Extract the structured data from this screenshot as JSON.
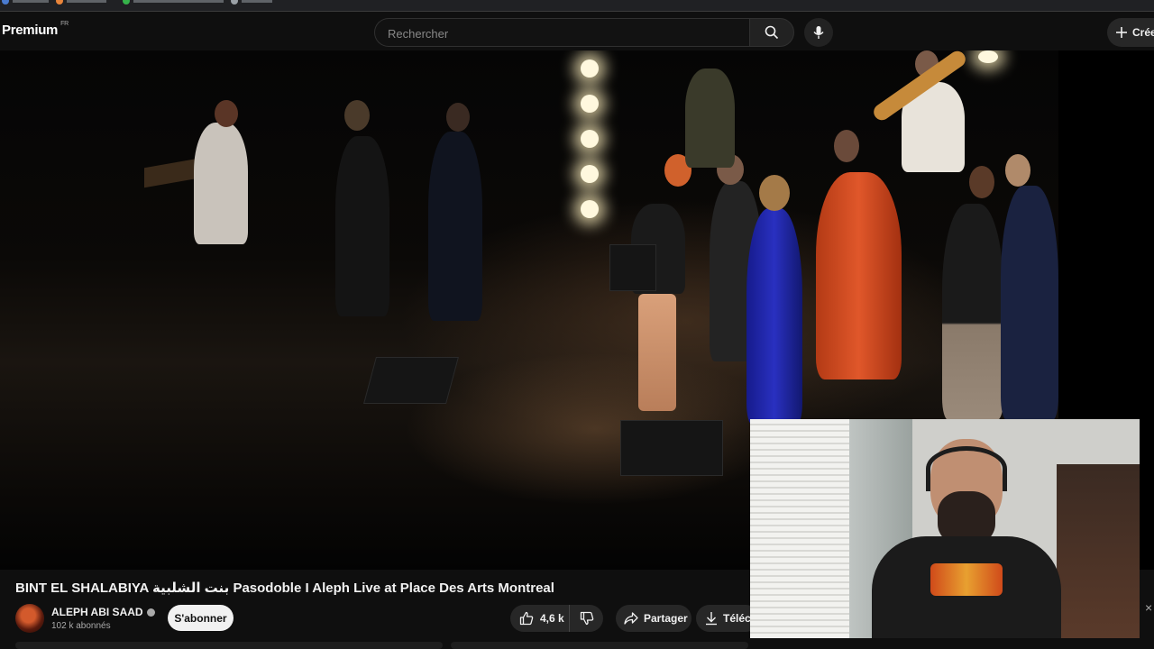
{
  "masthead": {
    "logo": "Premium",
    "country_code": "FR",
    "search_placeholder": "Rechercher",
    "create_label": "Créer"
  },
  "video": {
    "title": "BINT EL SHALABIYA بنت الشلبية Pasodoble I Aleph Live at Place Des Arts Montreal",
    "channel_name": "ALEPH ABI SAAD",
    "subscribers": "102 k abonnés",
    "subscribe_label": "S'abonner",
    "like_count": "4,6 k",
    "share_label": "Partager",
    "download_label": "Téléc"
  },
  "colors": {
    "background": "#0f0f0f",
    "pill": "#272727",
    "subscribe_bg": "#f1f1f1"
  },
  "icons": {
    "search": "search-icon",
    "mic": "mic-icon",
    "create": "plus-icon",
    "like": "thumbs-up-icon",
    "dislike": "thumbs-down-icon",
    "share": "share-icon",
    "download": "download-icon"
  }
}
